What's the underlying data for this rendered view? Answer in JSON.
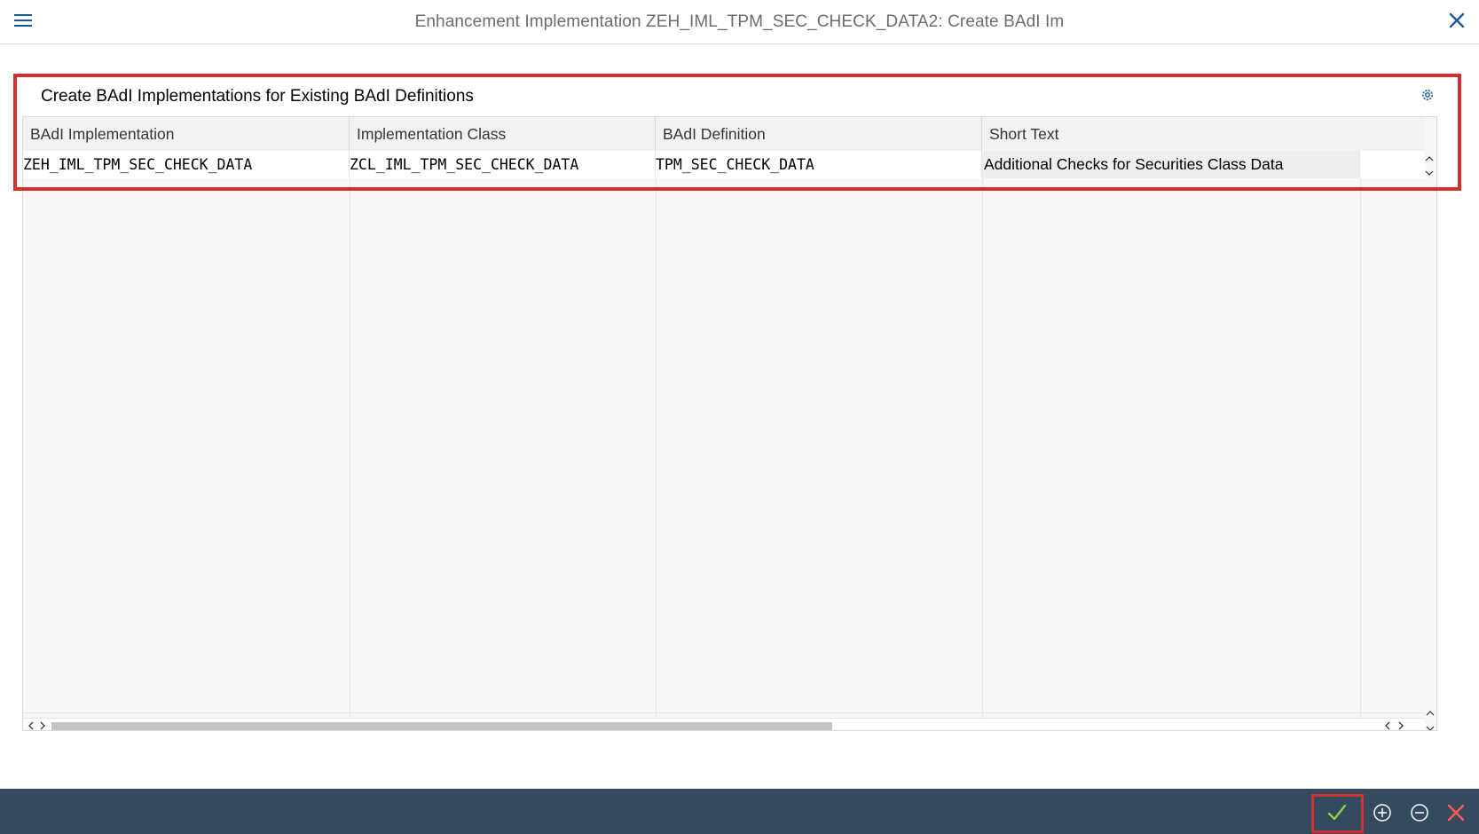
{
  "window": {
    "title": "Enhancement Implementation ZEH_IML_TPM_SEC_CHECK_DATA2: Create BAdI Im",
    "menu_icon": "hamburger-menu-icon",
    "close_icon": "close-icon"
  },
  "section": {
    "title": "Create BAdI Implementations for Existing BAdI Definitions",
    "settings_icon": "gear-icon"
  },
  "table": {
    "columns": [
      "BAdI Implementation",
      "Implementation Class",
      "BAdI Definition",
      "Short Text"
    ],
    "rows": [
      {
        "implementation": "ZEH_IML_TPM_SEC_CHECK_DATA",
        "class": "ZCL_IML_TPM_SEC_CHECK_DATA",
        "definition": "TPM_SEC_CHECK_DATA",
        "short_text": "Additional Checks for Securities Class Data"
      }
    ]
  },
  "footer": {
    "buttons": [
      "confirm-checkmark-icon",
      "add-circle-icon",
      "remove-circle-icon",
      "cancel-x-icon"
    ]
  },
  "colors": {
    "highlight": "#d0312d",
    "footer_bg": "#354a5f",
    "accent": "#1a5a96",
    "confirm": "#8fd14f",
    "cancel": "#ff5a5a"
  }
}
